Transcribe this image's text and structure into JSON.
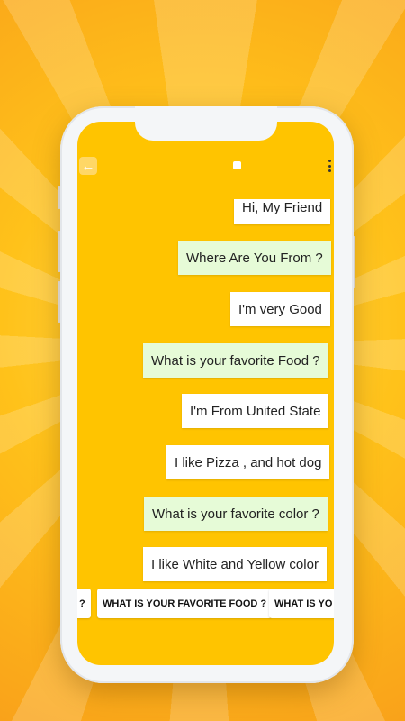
{
  "toolbar": {
    "back_icon": "arrow-left-icon",
    "center_icon": "square-icon",
    "menu_icon": "more-vertical-icon"
  },
  "messages": [
    {
      "text": "Hi, My Friend",
      "style": "white"
    },
    {
      "text": "Where Are You From ?",
      "style": "green"
    },
    {
      "text": "I'm very Good",
      "style": "white"
    },
    {
      "text": "What is your favorite Food ?",
      "style": "green"
    },
    {
      "text": "I'm From United State",
      "style": "white"
    },
    {
      "text": "I like Pizza , and hot dog",
      "style": "white"
    },
    {
      "text": "What is your favorite color ?",
      "style": "green"
    },
    {
      "text": "I like White and Yellow color",
      "style": "white"
    }
  ],
  "suggestions": [
    {
      "text": "?"
    },
    {
      "text": "WHAT IS YOUR FAVORITE FOOD ?"
    },
    {
      "text": "WHAT IS YO"
    }
  ],
  "colors": {
    "screen": "#ffc400",
    "bubble_white": "#ffffff",
    "bubble_green": "#e6fbd7"
  }
}
